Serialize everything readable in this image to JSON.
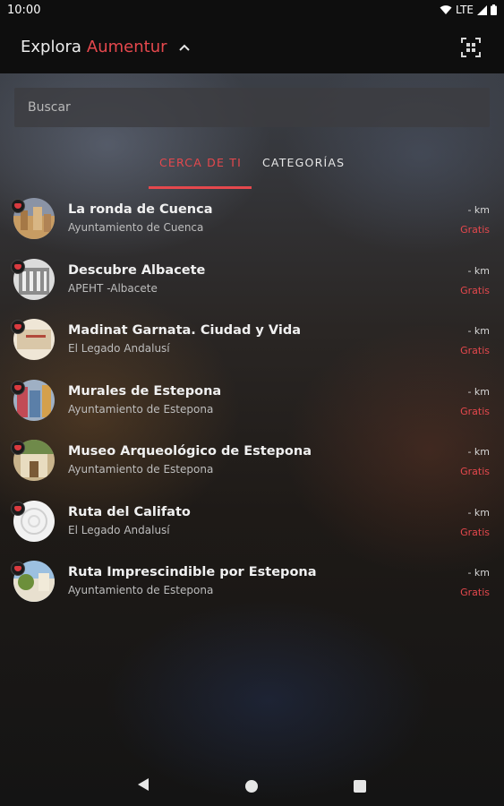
{
  "status_bar": {
    "time": "10:00",
    "network": "LTE"
  },
  "app_bar": {
    "title_prefix": "Explora",
    "title_brand": "Aumentur",
    "brand_color": "#e5484d"
  },
  "search": {
    "placeholder": "Buscar",
    "value": ""
  },
  "tabs": [
    {
      "label": "CERCA DE TI",
      "active": true
    },
    {
      "label": "CATEGORÍAS",
      "active": false
    }
  ],
  "items": [
    {
      "title": "La ronda de Cuenca",
      "subtitle": "Ayuntamiento de Cuenca",
      "distance": "- km",
      "price": "Gratis"
    },
    {
      "title": "Descubre Albacete",
      "subtitle": "APEHT -Albacete",
      "distance": "- km",
      "price": "Gratis"
    },
    {
      "title": "Madinat Garnata. Ciudad y Vida",
      "subtitle": "El Legado Andalusí",
      "distance": "- km",
      "price": "Gratis"
    },
    {
      "title": "Murales de Estepona",
      "subtitle": "Ayuntamiento de Estepona",
      "distance": "- km",
      "price": "Gratis"
    },
    {
      "title": "Museo Arqueológico de Estepona",
      "subtitle": "Ayuntamiento de Estepona",
      "distance": "- km",
      "price": "Gratis"
    },
    {
      "title": "Ruta del Califato",
      "subtitle": "El Legado Andalusí",
      "distance": "- km",
      "price": "Gratis"
    },
    {
      "title": "Ruta Imprescindible por Estepona",
      "subtitle": "Ayuntamiento de Estepona",
      "distance": "- km",
      "price": "Gratis"
    }
  ]
}
